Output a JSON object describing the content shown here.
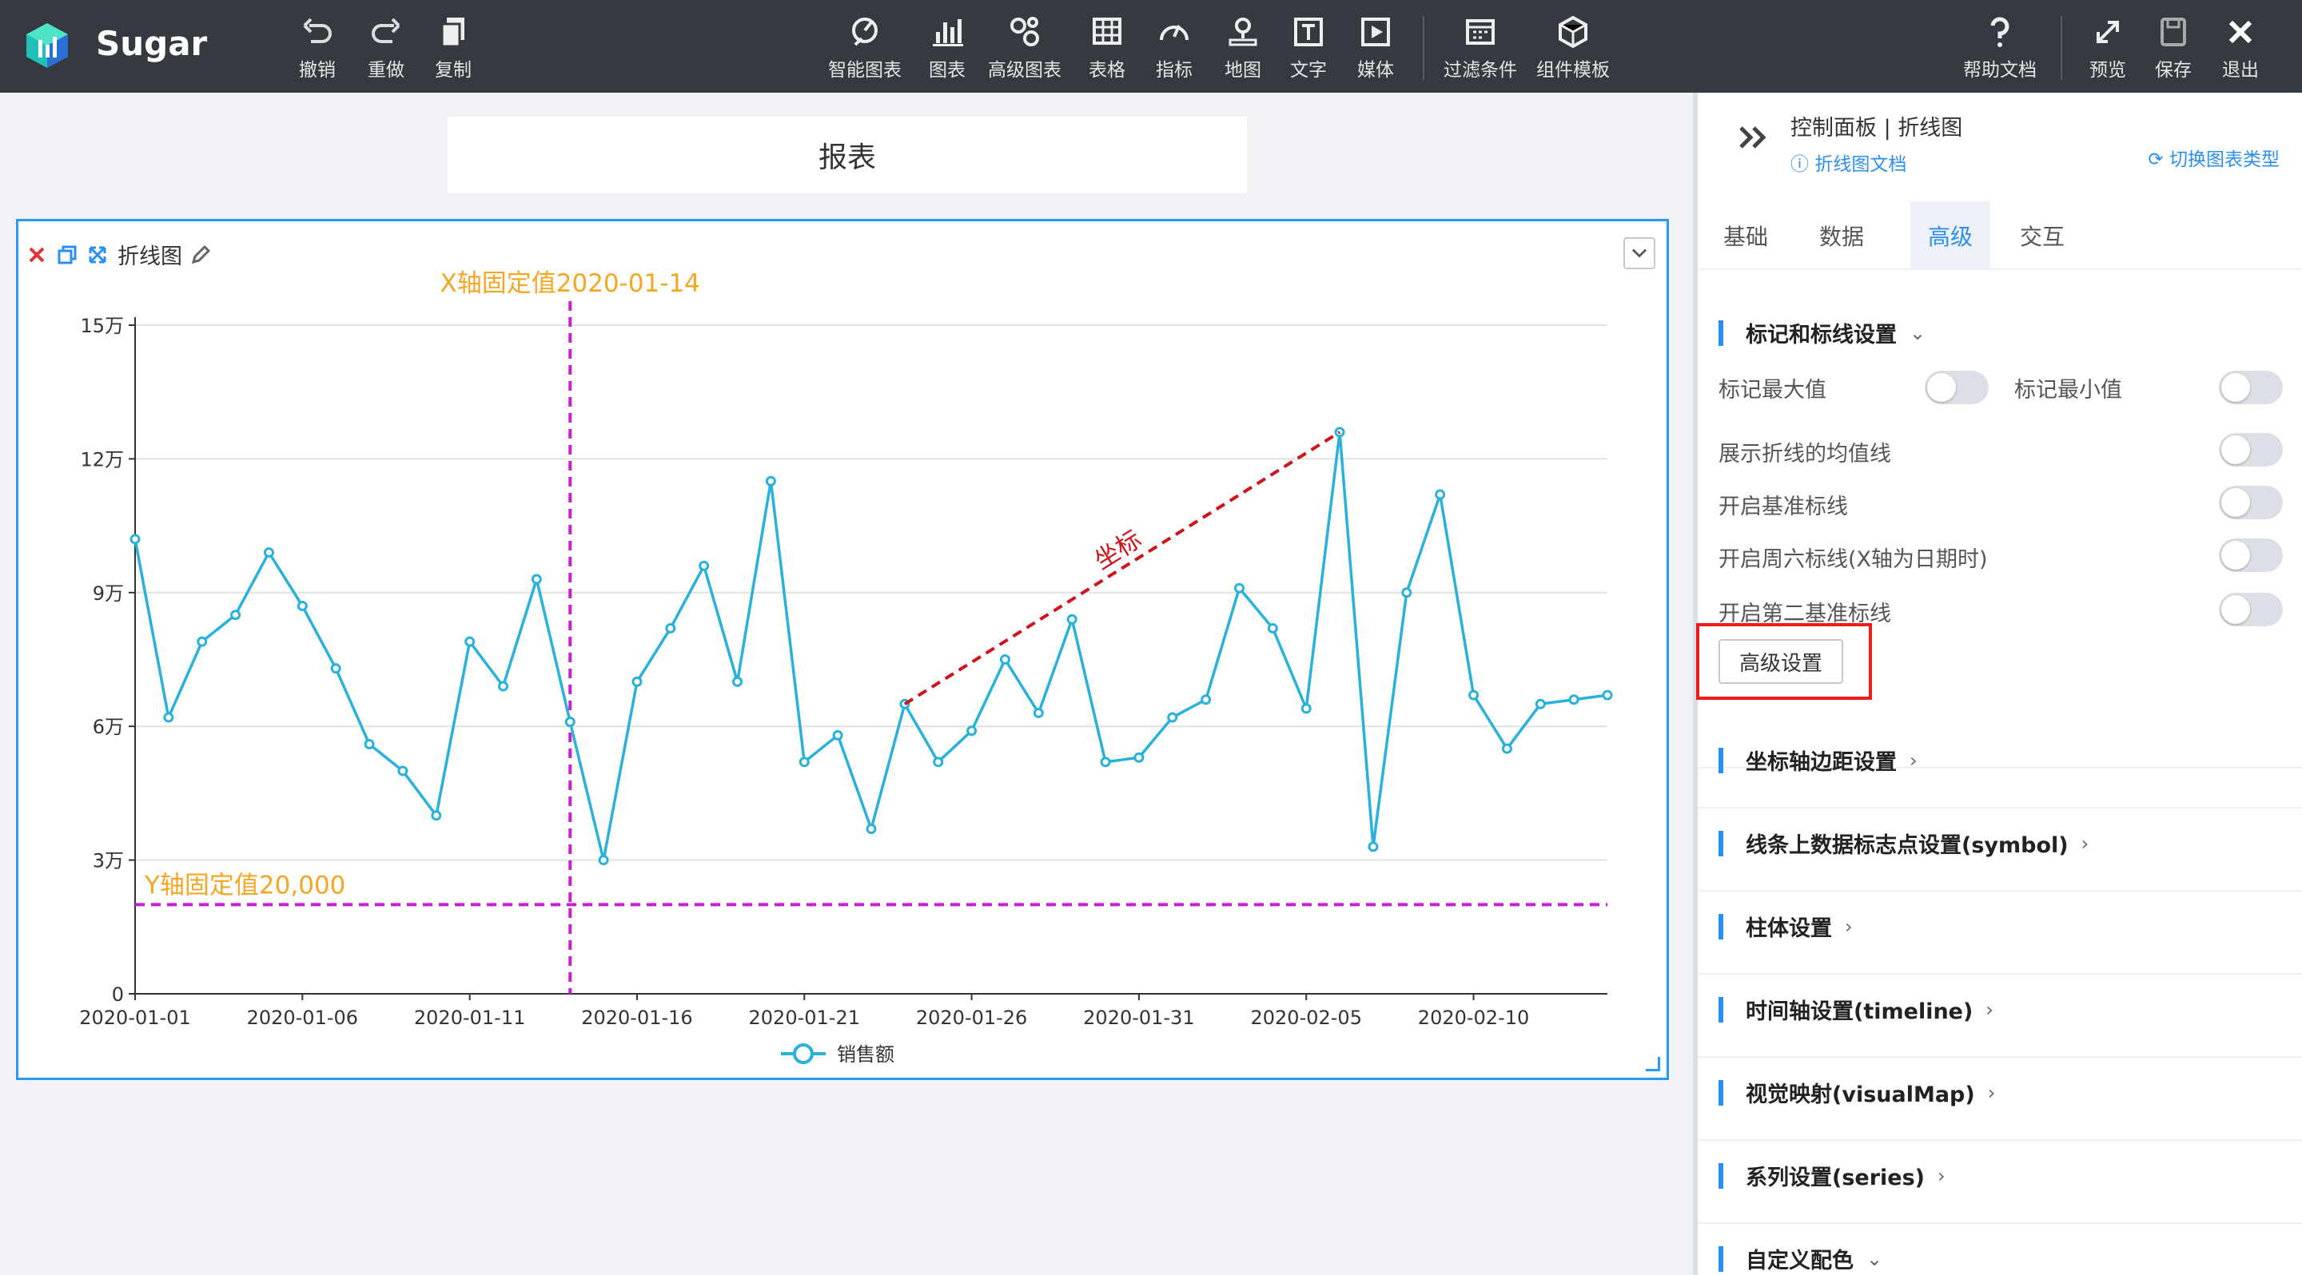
{
  "toolbar": {
    "brand": "Sugar",
    "undo": "撤销",
    "redo": "重做",
    "copy": "复制",
    "smart_chart": "智能图表",
    "chart": "图表",
    "advanced_chart": "高级图表",
    "table": "表格",
    "indicator": "指标",
    "map": "地图",
    "text": "文字",
    "media": "媒体",
    "filter": "过滤条件",
    "component_template": "组件模板",
    "help_doc": "帮助文档",
    "preview": "预览",
    "save": "保存",
    "exit": "退出"
  },
  "report_title": "报表",
  "chart_widget": {
    "title": "折线图"
  },
  "chart_data": {
    "type": "line",
    "x_tick_labels": [
      "2020-01-01",
      "2020-01-06",
      "2020-01-11",
      "2020-01-16",
      "2020-01-21",
      "2020-01-26",
      "2020-01-31",
      "2020-02-05",
      "2020-02-10"
    ],
    "y_tick_labels": [
      "0",
      "3万",
      "6万",
      "9万",
      "12万",
      "15万"
    ],
    "ylim": [
      0,
      150000
    ],
    "x": [
      "2020-01-01",
      "2020-01-02",
      "2020-01-03",
      "2020-01-04",
      "2020-01-05",
      "2020-01-06",
      "2020-01-07",
      "2020-01-08",
      "2020-01-09",
      "2020-01-10",
      "2020-01-11",
      "2020-01-12",
      "2020-01-13",
      "2020-01-14",
      "2020-01-15",
      "2020-01-16",
      "2020-01-17",
      "2020-01-18",
      "2020-01-19",
      "2020-01-20",
      "2020-01-21",
      "2020-01-22",
      "2020-01-23",
      "2020-01-24",
      "2020-01-25",
      "2020-01-26",
      "2020-01-27",
      "2020-01-28",
      "2020-01-29",
      "2020-01-30",
      "2020-01-31",
      "2020-02-01",
      "2020-02-02",
      "2020-02-03",
      "2020-02-04",
      "2020-02-05",
      "2020-02-06",
      "2020-02-07",
      "2020-02-08",
      "2020-02-09",
      "2020-02-10",
      "2020-02-11",
      "2020-02-12",
      "2020-02-13",
      "2020-02-14"
    ],
    "series": [
      {
        "name": "销售额",
        "color": "#29b1dc",
        "values": [
          102000,
          62000,
          79000,
          85000,
          99000,
          87000,
          73000,
          56000,
          50000,
          40000,
          79000,
          69000,
          93000,
          61000,
          30000,
          70000,
          82000,
          96000,
          70000,
          115000,
          52000,
          58000,
          37000,
          65000,
          52000,
          59000,
          75000,
          63000,
          84000,
          52000,
          53000,
          62000,
          66000,
          91000,
          82000,
          64000,
          126000,
          33000,
          90000,
          112000,
          67000,
          55000,
          65000,
          66000,
          67000
        ]
      }
    ],
    "mark_lines": {
      "x_fixed": {
        "label": "X轴固定值2020-01-14",
        "value": "2020-01-14",
        "color": "#c81ed6"
      },
      "y_fixed": {
        "label": "Y轴固定值20,000",
        "value": 20000,
        "color": "#c81ed6"
      },
      "coordinate": {
        "label": "坐标",
        "from": [
          "2020-01-24",
          65000
        ],
        "to": [
          "2020-02-06",
          126000
        ],
        "color": "#d0121b"
      }
    },
    "label_color": "#f5a623",
    "grid": true,
    "legend": "bottom-center"
  },
  "panel": {
    "title": "控制面板 | 折线图",
    "doc_link": "折线图文档",
    "switch_type": "切换图表类型",
    "tabs": [
      "基础",
      "数据",
      "高级",
      "交互"
    ],
    "active_tab": "高级",
    "sections": {
      "marks": "标记和标线设置",
      "axis_margin": "坐标轴边距设置",
      "symbol": "线条上数据标志点设置(symbol)",
      "bar": "柱体设置",
      "timeline": "时间轴设置(timeline)",
      "visualmap": "视觉映射(visualMap)",
      "series": "系列设置(series)",
      "custom_color": "自定义配色"
    },
    "rows": {
      "mark_max": "标记最大值",
      "mark_min": "标记最小值",
      "show_avg": "展示折线的均值线",
      "base_line": "开启基准标线",
      "saturday_line": "开启周六标线(X轴为日期时)",
      "second_base_line": "开启第二基准标线"
    },
    "advanced_button": "高级设置"
  }
}
